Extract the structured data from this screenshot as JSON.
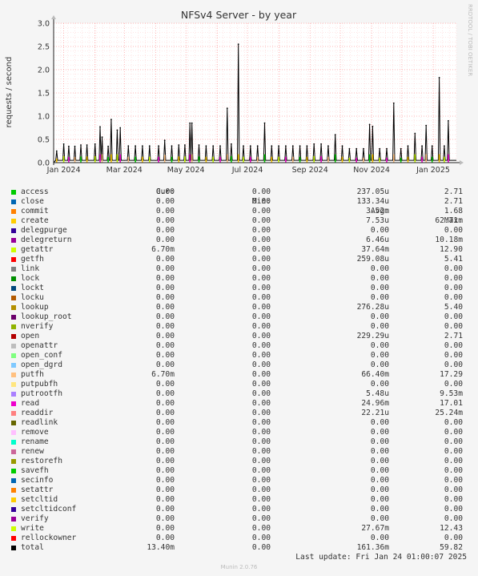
{
  "chart_data": {
    "type": "area",
    "title": "NFSv4 Server - by year",
    "ylabel": "requests / second",
    "watermark": "RRDTOOL / TOBI OETIKER",
    "ylim": [
      0,
      3.0
    ],
    "y_ticks": [
      "0.0",
      "0.5",
      "1.0",
      "1.5",
      "2.0",
      "2.5",
      "3.0"
    ],
    "x_ticks": [
      "Jan 2024",
      "Mar 2024",
      "May 2024",
      "Jul 2024",
      "Sep 2024",
      "Nov 2024",
      "Jan 2025"
    ],
    "x_range": [
      "2023-12-22",
      "2025-01-24"
    ],
    "grid": true,
    "total_peaks": [
      {
        "x": "2023-12-25",
        "y": 0.25
      },
      {
        "x": "2024-01-01",
        "y": 0.4
      },
      {
        "x": "2024-01-06",
        "y": 0.35
      },
      {
        "x": "2024-01-12",
        "y": 0.35
      },
      {
        "x": "2024-01-18",
        "y": 0.38
      },
      {
        "x": "2024-01-24",
        "y": 0.38
      },
      {
        "x": "2024-02-01",
        "y": 0.4
      },
      {
        "x": "2024-02-06",
        "y": 0.77
      },
      {
        "x": "2024-02-08",
        "y": 0.55
      },
      {
        "x": "2024-02-14",
        "y": 0.35
      },
      {
        "x": "2024-02-17",
        "y": 0.93
      },
      {
        "x": "2024-02-23",
        "y": 0.7
      },
      {
        "x": "2024-02-26",
        "y": 0.75
      },
      {
        "x": "2024-03-05",
        "y": 0.36
      },
      {
        "x": "2024-03-12",
        "y": 0.36
      },
      {
        "x": "2024-03-19",
        "y": 0.36
      },
      {
        "x": "2024-03-26",
        "y": 0.36
      },
      {
        "x": "2024-04-04",
        "y": 0.36
      },
      {
        "x": "2024-04-10",
        "y": 0.48
      },
      {
        "x": "2024-04-17",
        "y": 0.36
      },
      {
        "x": "2024-04-24",
        "y": 0.38
      },
      {
        "x": "2024-04-30",
        "y": 0.38
      },
      {
        "x": "2024-05-05",
        "y": 0.85
      },
      {
        "x": "2024-05-07",
        "y": 0.85
      },
      {
        "x": "2024-05-14",
        "y": 0.38
      },
      {
        "x": "2024-05-21",
        "y": 0.36
      },
      {
        "x": "2024-05-28",
        "y": 0.36
      },
      {
        "x": "2024-06-04",
        "y": 0.36
      },
      {
        "x": "2024-06-11",
        "y": 1.17
      },
      {
        "x": "2024-06-15",
        "y": 0.4
      },
      {
        "x": "2024-06-22",
        "y": 2.55
      },
      {
        "x": "2024-06-27",
        "y": 0.36
      },
      {
        "x": "2024-07-04",
        "y": 0.36
      },
      {
        "x": "2024-07-11",
        "y": 0.36
      },
      {
        "x": "2024-07-18",
        "y": 0.85
      },
      {
        "x": "2024-07-25",
        "y": 0.36
      },
      {
        "x": "2024-08-01",
        "y": 0.36
      },
      {
        "x": "2024-08-08",
        "y": 0.36
      },
      {
        "x": "2024-08-15",
        "y": 0.36
      },
      {
        "x": "2024-08-22",
        "y": 0.36
      },
      {
        "x": "2024-08-29",
        "y": 0.36
      },
      {
        "x": "2024-09-05",
        "y": 0.4
      },
      {
        "x": "2024-09-12",
        "y": 0.4
      },
      {
        "x": "2024-09-19",
        "y": 0.36
      },
      {
        "x": "2024-09-26",
        "y": 0.6
      },
      {
        "x": "2024-10-03",
        "y": 0.36
      },
      {
        "x": "2024-10-10",
        "y": 0.3
      },
      {
        "x": "2024-10-17",
        "y": 0.3
      },
      {
        "x": "2024-10-24",
        "y": 0.3
      },
      {
        "x": "2024-10-30",
        "y": 0.82
      },
      {
        "x": "2024-11-02",
        "y": 0.78
      },
      {
        "x": "2024-11-09",
        "y": 0.3
      },
      {
        "x": "2024-11-16",
        "y": 0.3
      },
      {
        "x": "2024-11-23",
        "y": 1.28
      },
      {
        "x": "2024-11-30",
        "y": 0.3
      },
      {
        "x": "2024-12-07",
        "y": 0.36
      },
      {
        "x": "2024-12-14",
        "y": 0.63
      },
      {
        "x": "2024-12-21",
        "y": 0.36
      },
      {
        "x": "2024-12-25",
        "y": 0.8
      },
      {
        "x": "2024-12-31",
        "y": 0.36
      },
      {
        "x": "2025-01-07",
        "y": 1.83
      },
      {
        "x": "2025-01-12",
        "y": 0.36
      },
      {
        "x": "2025-01-16",
        "y": 0.9
      }
    ]
  },
  "legend": {
    "headers": {
      "cur": "Cur:",
      "min": "Min:",
      "avg": "Avg:",
      "max": "Max:"
    },
    "rows": [
      {
        "name": "access",
        "color": "#00cc00",
        "cur": "0.00",
        "min": "0.00",
        "avg": "237.05u",
        "max": "2.71"
      },
      {
        "name": "close",
        "color": "#0066b3",
        "cur": "0.00",
        "min": "0.00",
        "avg": "133.34u",
        "max": "2.71"
      },
      {
        "name": "commit",
        "color": "#ff8000",
        "cur": "0.00",
        "min": "0.00",
        "avg": "3.52m",
        "max": "1.68"
      },
      {
        "name": "create",
        "color": "#ffcc00",
        "cur": "0.00",
        "min": "0.00",
        "avg": "7.53u",
        "max": "62.71m"
      },
      {
        "name": "delegpurge",
        "color": "#330099",
        "cur": "0.00",
        "min": "0.00",
        "avg": "0.00",
        "max": "0.00"
      },
      {
        "name": "delegreturn",
        "color": "#990099",
        "cur": "0.00",
        "min": "0.00",
        "avg": "6.46u",
        "max": "10.18m"
      },
      {
        "name": "getattr",
        "color": "#ccff00",
        "cur": "6.70m",
        "min": "0.00",
        "avg": "37.64m",
        "max": "12.90"
      },
      {
        "name": "getfh",
        "color": "#ff0000",
        "cur": "0.00",
        "min": "0.00",
        "avg": "259.08u",
        "max": "5.41"
      },
      {
        "name": "link",
        "color": "#808080",
        "cur": "0.00",
        "min": "0.00",
        "avg": "0.00",
        "max": "0.00"
      },
      {
        "name": "lock",
        "color": "#008f00",
        "cur": "0.00",
        "min": "0.00",
        "avg": "0.00",
        "max": "0.00"
      },
      {
        "name": "lockt",
        "color": "#00487d",
        "cur": "0.00",
        "min": "0.00",
        "avg": "0.00",
        "max": "0.00"
      },
      {
        "name": "locku",
        "color": "#b35a00",
        "cur": "0.00",
        "min": "0.00",
        "avg": "0.00",
        "max": "0.00"
      },
      {
        "name": "lookup",
        "color": "#b38f00",
        "cur": "0.00",
        "min": "0.00",
        "avg": "276.28u",
        "max": "5.40"
      },
      {
        "name": "lookup_root",
        "color": "#6b006b",
        "cur": "0.00",
        "min": "0.00",
        "avg": "0.00",
        "max": "0.00"
      },
      {
        "name": "nverify",
        "color": "#8fb300",
        "cur": "0.00",
        "min": "0.00",
        "avg": "0.00",
        "max": "0.00"
      },
      {
        "name": "open",
        "color": "#b30000",
        "cur": "0.00",
        "min": "0.00",
        "avg": "229.29u",
        "max": "2.71"
      },
      {
        "name": "openattr",
        "color": "#bebebe",
        "cur": "0.00",
        "min": "0.00",
        "avg": "0.00",
        "max": "0.00"
      },
      {
        "name": "open_conf",
        "color": "#80ff80",
        "cur": "0.00",
        "min": "0.00",
        "avg": "0.00",
        "max": "0.00"
      },
      {
        "name": "open_dgrd",
        "color": "#80c9ff",
        "cur": "0.00",
        "min": "0.00",
        "avg": "0.00",
        "max": "0.00"
      },
      {
        "name": "putfh",
        "color": "#ffc080",
        "cur": "6.70m",
        "min": "0.00",
        "avg": "66.40m",
        "max": "17.29"
      },
      {
        "name": "putpubfh",
        "color": "#ffe680",
        "cur": "0.00",
        "min": "0.00",
        "avg": "0.00",
        "max": "0.00"
      },
      {
        "name": "putrootfh",
        "color": "#aa80ff",
        "cur": "0.00",
        "min": "0.00",
        "avg": "5.48u",
        "max": "9.53m"
      },
      {
        "name": "read",
        "color": "#ee00cc",
        "cur": "0.00",
        "min": "0.00",
        "avg": "24.96m",
        "max": "17.01"
      },
      {
        "name": "readdir",
        "color": "#ff8080",
        "cur": "0.00",
        "min": "0.00",
        "avg": "22.21u",
        "max": "25.24m"
      },
      {
        "name": "readlink",
        "color": "#666600",
        "cur": "0.00",
        "min": "0.00",
        "avg": "0.00",
        "max": "0.00"
      },
      {
        "name": "remove",
        "color": "#ffbfff",
        "cur": "0.00",
        "min": "0.00",
        "avg": "0.00",
        "max": "0.00"
      },
      {
        "name": "rename",
        "color": "#00ffcc",
        "cur": "0.00",
        "min": "0.00",
        "avg": "0.00",
        "max": "0.00"
      },
      {
        "name": "renew",
        "color": "#cc6699",
        "cur": "0.00",
        "min": "0.00",
        "avg": "0.00",
        "max": "0.00"
      },
      {
        "name": "restorefh",
        "color": "#999900",
        "cur": "0.00",
        "min": "0.00",
        "avg": "0.00",
        "max": "0.00"
      },
      {
        "name": "savefh",
        "color": "#00cc00",
        "cur": "0.00",
        "min": "0.00",
        "avg": "0.00",
        "max": "0.00"
      },
      {
        "name": "secinfo",
        "color": "#0066b3",
        "cur": "0.00",
        "min": "0.00",
        "avg": "0.00",
        "max": "0.00"
      },
      {
        "name": "setattr",
        "color": "#ff8000",
        "cur": "0.00",
        "min": "0.00",
        "avg": "0.00",
        "max": "0.00"
      },
      {
        "name": "setcltid",
        "color": "#ffcc00",
        "cur": "0.00",
        "min": "0.00",
        "avg": "0.00",
        "max": "0.00"
      },
      {
        "name": "setcltidconf",
        "color": "#330099",
        "cur": "0.00",
        "min": "0.00",
        "avg": "0.00",
        "max": "0.00"
      },
      {
        "name": "verify",
        "color": "#990099",
        "cur": "0.00",
        "min": "0.00",
        "avg": "0.00",
        "max": "0.00"
      },
      {
        "name": "write",
        "color": "#ccff00",
        "cur": "0.00",
        "min": "0.00",
        "avg": "27.67m",
        "max": "12.43"
      },
      {
        "name": "rellockowner",
        "color": "#ff0000",
        "cur": "0.00",
        "min": "0.00",
        "avg": "0.00",
        "max": "0.00"
      },
      {
        "name": "total",
        "color": "#000000",
        "cur": "13.40m",
        "min": "0.00",
        "avg": "161.36m",
        "max": "59.82"
      }
    ]
  },
  "footer": {
    "last_update": "Last update: Fri Jan 24 01:00:07 2025",
    "version": "Munin 2.0.76"
  }
}
